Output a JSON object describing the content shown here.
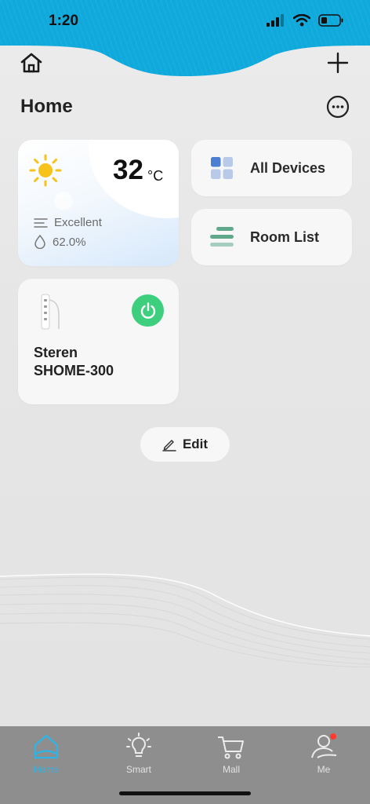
{
  "status_bar": {
    "time": "1:20"
  },
  "header": {
    "title": "Home"
  },
  "weather": {
    "temperature": "32",
    "unit": "°C",
    "air_quality": "Excellent",
    "humidity": "62.0%"
  },
  "shortcuts": [
    {
      "label": "All Devices"
    },
    {
      "label": "Room List"
    }
  ],
  "device": {
    "name": "Steren SHOME-300",
    "power_on": true
  },
  "edit": {
    "label": "Edit"
  },
  "tabs": [
    {
      "label": "Home",
      "active": true
    },
    {
      "label": "Smart",
      "active": false
    },
    {
      "label": "Mall",
      "active": false
    },
    {
      "label": "Me",
      "active": false
    }
  ],
  "colors": {
    "accent": "#2bb5e8",
    "power": "#3ecf7e",
    "wave": "#10a9dc",
    "notification": "#ff3b30"
  }
}
